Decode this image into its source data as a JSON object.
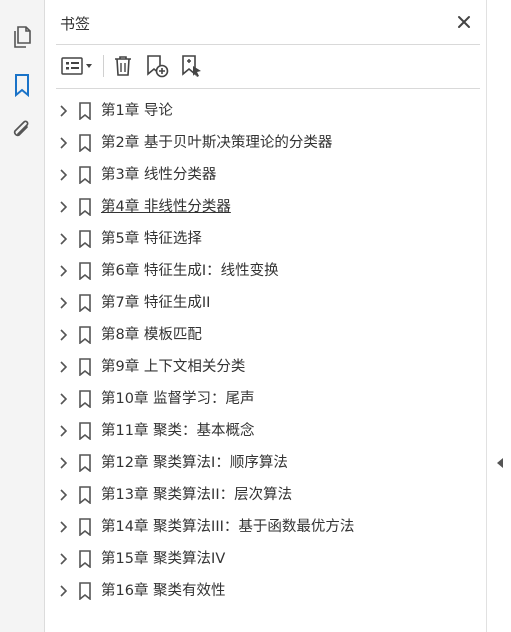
{
  "panel": {
    "title": "书签",
    "close_icon": "close-icon"
  },
  "rail": {
    "items": [
      {
        "name": "pages-icon"
      },
      {
        "name": "bookmark-icon",
        "active": true
      },
      {
        "name": "attachment-icon"
      }
    ],
    "accent": "#1a73c8"
  },
  "toolbar": {
    "items": [
      {
        "name": "options-menu-icon"
      },
      {
        "name": "delete-icon"
      },
      {
        "name": "new-bookmark-icon"
      },
      {
        "name": "new-bookmark-from-structure-icon"
      }
    ]
  },
  "bookmarks": [
    {
      "label": "第1章  导论"
    },
    {
      "label": "第2章  基于贝叶斯决策理论的分类器"
    },
    {
      "label": "第3章  线性分类器"
    },
    {
      "label": "第4章  非线性分类器",
      "underlined": true
    },
    {
      "label": "第5章  特征选择"
    },
    {
      "label": "第6章  特征生成I：线性变换"
    },
    {
      "label": "第7章  特征生成II"
    },
    {
      "label": "第8章  模板匹配"
    },
    {
      "label": "第9章  上下文相关分类"
    },
    {
      "label": "第10章  监督学习：尾声"
    },
    {
      "label": "第11章  聚类：基本概念"
    },
    {
      "label": "第12章  聚类算法I：顺序算法"
    },
    {
      "label": "第13章  聚类算法II：层次算法"
    },
    {
      "label": "第14章  聚类算法III：基于函数最优方法"
    },
    {
      "label": "第15章  聚类算法IV"
    },
    {
      "label": "第16章  聚类有效性"
    }
  ]
}
